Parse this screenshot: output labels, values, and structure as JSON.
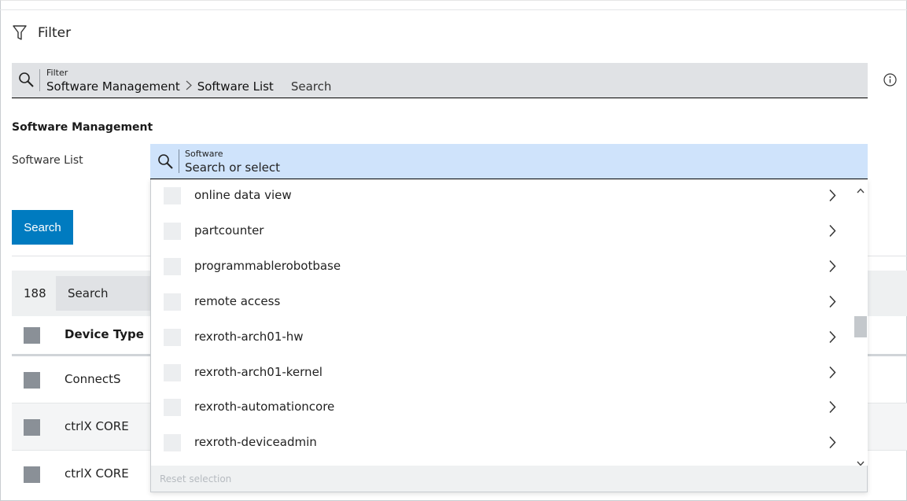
{
  "filter_header": {
    "title": "Filter"
  },
  "filter_bar": {
    "label": "Filter",
    "breadcrumb": [
      "Software Management",
      "Software List"
    ],
    "search_text": "Search"
  },
  "section": {
    "title": "Software Management",
    "field_label": "Software List"
  },
  "software_dropdown": {
    "label": "Software",
    "placeholder": "Search or select",
    "items": [
      {
        "label": "online data view"
      },
      {
        "label": "partcounter"
      },
      {
        "label": "programmablerobotbase"
      },
      {
        "label": "remote access"
      },
      {
        "label": "rexroth-arch01-hw"
      },
      {
        "label": "rexroth-arch01-kernel"
      },
      {
        "label": "rexroth-automationcore"
      },
      {
        "label": "rexroth-deviceadmin"
      }
    ],
    "reset_label": "Reset selection"
  },
  "search_button": {
    "label": "Search"
  },
  "results": {
    "count": "188",
    "search_label": "Search",
    "columns": {
      "device_type": "Device Type"
    },
    "rows": [
      {
        "device_type": "ConnectS"
      },
      {
        "device_type": "ctrlX CORE"
      },
      {
        "device_type": "ctrlX CORE"
      }
    ]
  },
  "colors": {
    "primary_button": "#007bc0",
    "dropdown_input_bg": "#cfe3fb",
    "filter_bar_bg": "#e0e2e5"
  },
  "icons": {
    "filter": "funnel-icon",
    "search": "magnifier-icon",
    "info": "info-circle-icon",
    "chevron": "chevron-right-icon"
  }
}
